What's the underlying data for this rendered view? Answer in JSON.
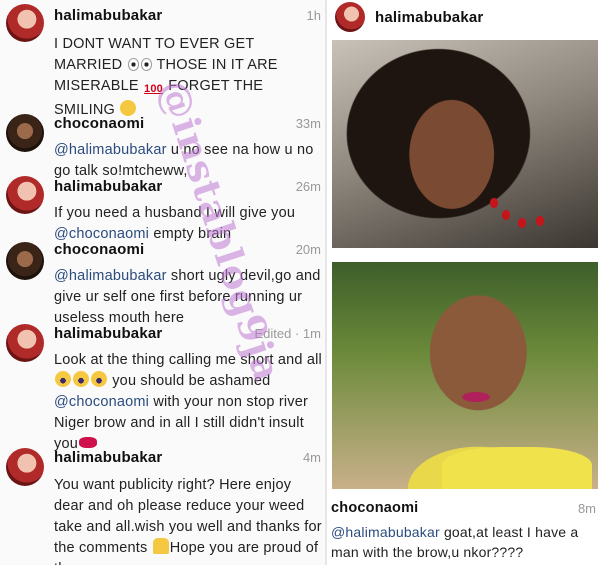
{
  "left_comments": [
    {
      "user": "halimabubakar",
      "time": "1h",
      "text_before": "I DONT WANT TO EVER GET MARRIED",
      "text_after": "THOSE IN IT ARE MISERABLE",
      "text_end": "FORGET THE SMILING",
      "emoji_1": "eyes-emoji",
      "emoji_2": "hundred-emoji",
      "emoji_3": "thinking-emoji",
      "hundred_text": "100"
    },
    {
      "user": "choconaomi",
      "time": "33m",
      "mention": "@halimabubakar",
      "text": " u no see na how u no go talk so!mtcheww,"
    },
    {
      "user": "halimabubakar",
      "time": "26m",
      "text_before": "If you need a husband I will give you ",
      "mention": "@choconaomi",
      "text_after": " empty brain"
    },
    {
      "user": "choconaomi",
      "time": "20m",
      "mention": "@halimabubakar",
      "text": " short ugly devil,go and give ur self one first before running ur useless mouth here"
    },
    {
      "user": "halimabubakar",
      "time": "Edited · 1m",
      "text_before": "Look at the thing calling me short and all ",
      "text_mid": " you should be ashamed ",
      "mention": "@choconaomi",
      "text_after": " with your non stop river Niger brow and in all I still didn't insult you"
    },
    {
      "user": "halimabubakar",
      "time": "4m",
      "text_before": "You want publicity right? Here enjoy dear and oh please reduce your weed take and all.wish you well and thanks for the comments ",
      "text_after": "Hope you are proud of them"
    }
  ],
  "right_post": {
    "header_user": "halimabubakar",
    "comment_user": "choconaomi",
    "comment_time": "8m",
    "comment_mention": "@halimabubakar",
    "comment_text": " goat,at least I have a man with the brow,u nkor????"
  },
  "watermark": "@instablog9ja",
  "colors": {
    "mention": "#2b4c7e",
    "watermark": "#bc78d2",
    "username": "#111111"
  }
}
